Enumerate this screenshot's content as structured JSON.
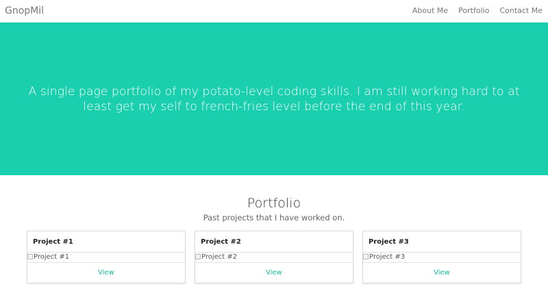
{
  "navbar": {
    "brand": "GnopMil",
    "links": [
      "About Me",
      "Portfolio",
      "Contact Me"
    ]
  },
  "hero": {
    "text_line_1": "A single page portfolio of my potato-level coding skills. I am still working hard to at",
    "text_line_2": "least get my self to french-fries level before the end of this year."
  },
  "portfolio": {
    "title": "Portfolio",
    "subtitle": "Past projects that I have worked on.",
    "projects": [
      {
        "title": "Project #1",
        "image_alt": "Project #1",
        "link": "View"
      },
      {
        "title": "Project #2",
        "image_alt": "Project #2",
        "link": "View"
      },
      {
        "title": "Project #3",
        "image_alt": "Project #3",
        "link": "View"
      }
    ]
  },
  "colors": {
    "hero_background": "#1acfae",
    "accent": "#18bc9c",
    "nav_text": "#777777"
  },
  "icons": [
    "broken-image-icon"
  ]
}
